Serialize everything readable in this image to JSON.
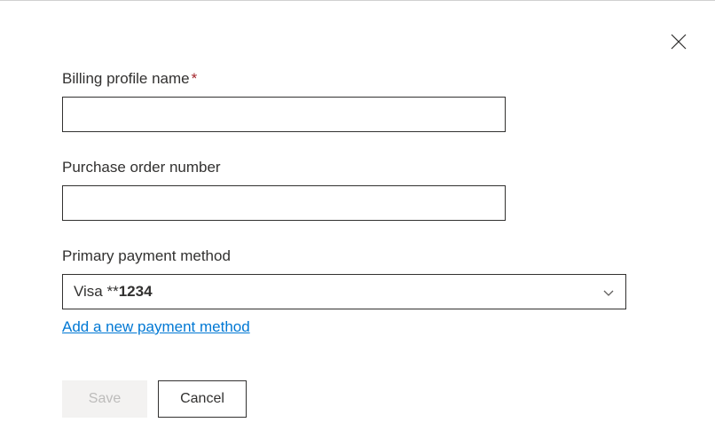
{
  "labels": {
    "billingProfileName": "Billing profile name",
    "purchaseOrderNumber": "Purchase order number",
    "primaryPaymentMethod": "Primary payment method"
  },
  "values": {
    "billingProfileName": "",
    "purchaseOrderNumber": "",
    "paymentMethodPrefix": "Visa **",
    "paymentMethodLast4": "1234"
  },
  "links": {
    "addPaymentMethod": "Add a new payment method"
  },
  "buttons": {
    "save": "Save",
    "cancel": "Cancel"
  }
}
